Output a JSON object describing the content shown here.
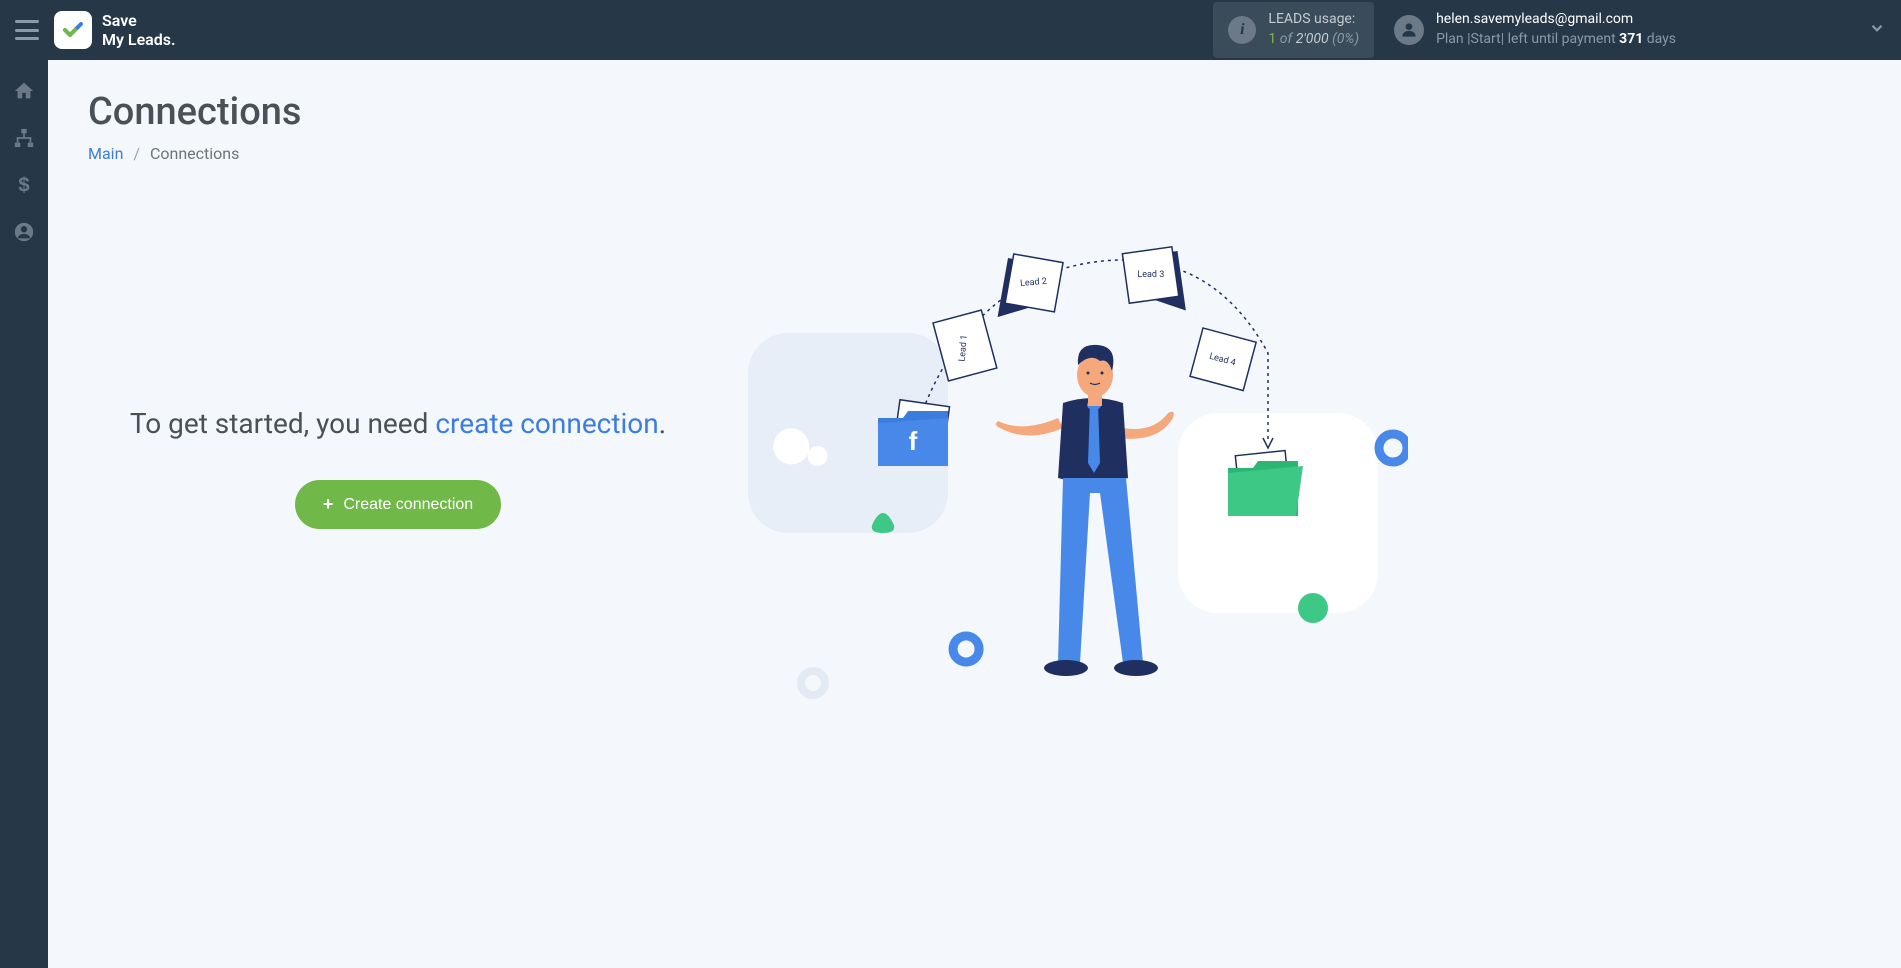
{
  "header": {
    "logo_line1": "Save",
    "logo_line2": "My Leads.",
    "leads_label": "LEADS usage:",
    "leads_count": "1",
    "leads_of": "of",
    "leads_total": "2'000",
    "leads_pct": "(0%)",
    "user_email": "helen.savemyleads@gmail.com",
    "plan_prefix": "Plan |Start| left until payment ",
    "plan_days": "371",
    "plan_suffix": " days"
  },
  "page": {
    "title": "Connections",
    "breadcrumb_main": "Main",
    "breadcrumb_current": "Connections"
  },
  "cta": {
    "text_prefix": "To get started, you need ",
    "text_link": "create connection",
    "text_suffix": ".",
    "button_label": "Create connection"
  },
  "illustration": {
    "lead1": "Lead 1",
    "lead2": "Lead 2",
    "lead3": "Lead 3",
    "lead4": "Lead 4",
    "fb": "f"
  }
}
